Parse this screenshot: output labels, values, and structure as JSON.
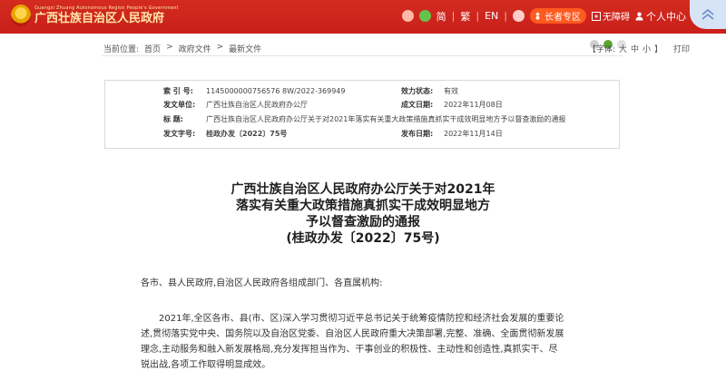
{
  "header": {
    "logo_en": "Guangxi Zhuang Autonomous Region People's Government",
    "logo_cn": "广西壮族自治区人民政府",
    "lang_simplified": "简",
    "lang_traditional": "繁",
    "lang_english": "EN",
    "elder_label": "长者专区",
    "accessibility_label": "无障碍",
    "user_center_label": "个人中心"
  },
  "breadcrumb": {
    "prefix": "当前位置:",
    "items": [
      "首页",
      "政府文件",
      "最新文件"
    ],
    "separator": ">"
  },
  "page_tools": {
    "font_label": "【字体:",
    "font_large": "大",
    "font_medium": "中",
    "font_small": "小",
    "font_close": "】",
    "print_label": "打印"
  },
  "meta": {
    "index_label": "索  引  号:",
    "index_value": "1145000000756576 8W/2022-369949",
    "issuer_label": "发文单位:",
    "issuer_value": "广西壮族自治区人民政府办公厅",
    "subject_label": "标      题:",
    "subject_value": "广西壮族自治区人民政府办公厅关于对2021年落实有关重大政策措施真抓实干成效明显地方予以督查激励的通报",
    "docno_label": "发文字号:",
    "docno_value": "桂政办发〔2022〕75号",
    "validity_label": "效力状态:",
    "validity_value": "有效",
    "created_label": "成文日期:",
    "created_value": "2022年11月08日",
    "published_label": "发布日期:",
    "published_value": "2022年11月14日"
  },
  "doc": {
    "title_lines": [
      "广西壮族自治区人民政府办公厅关于对2021年",
      "落实有关重大政策措施真抓实干成效明显地方",
      "予以督查激励的通报",
      "(桂政办发〔2022〕75号)"
    ],
    "addressee": "各市、县人民政府,自治区人民政府各组成部门、各直属机构:",
    "paragraph_lines": [
      "　　2021年,全区各市、县(市、区)深入学习贯彻习近平总书记关于统筹疫情防控和经济社会发展的重要论",
      "述,贯彻落实党中央、国务院以及自治区党委、自治区人民政府重大决策部署,完整、准确、全面贯彻新发展",
      "理念,主动服务和融入新发展格局,充分发挥担当作为、干事创业的积极性、主动性和创造性,真抓实干、尽",
      "锐出战,各项工作取得明显成效。"
    ]
  }
}
